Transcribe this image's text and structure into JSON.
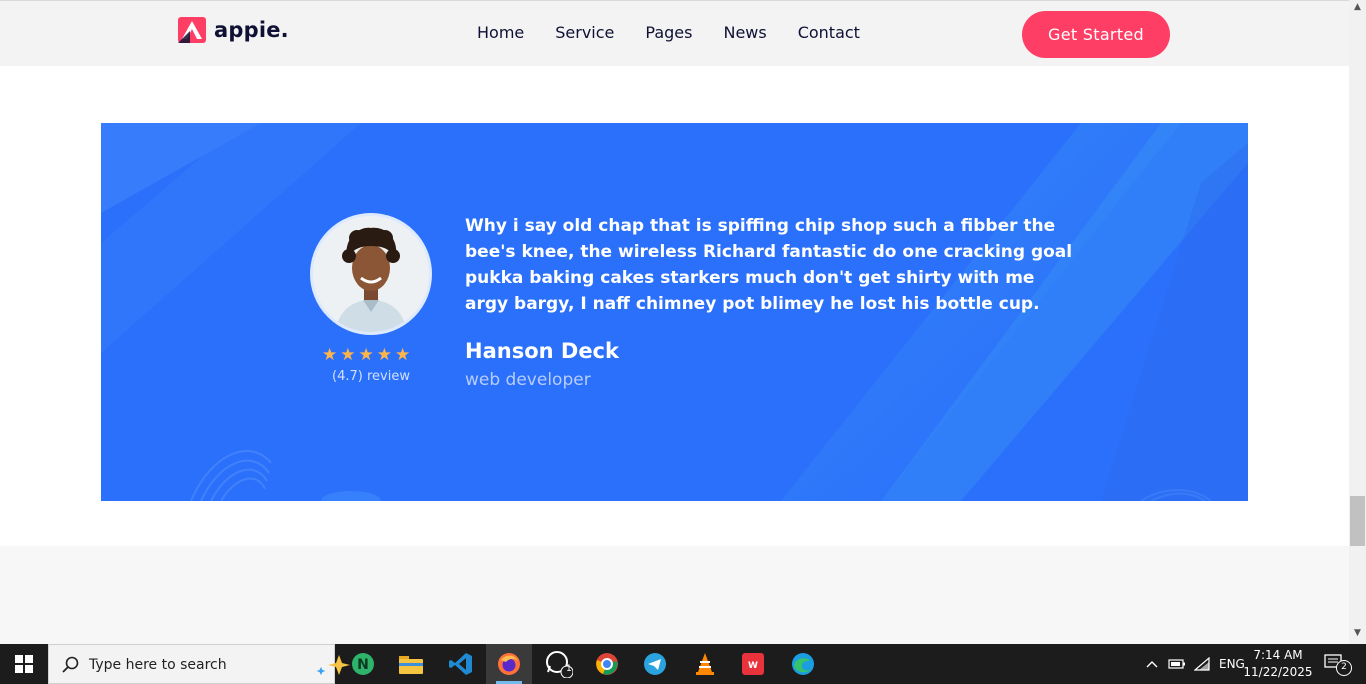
{
  "brand": {
    "name": "appie.",
    "accent": "#ff3e66"
  },
  "nav": {
    "items": [
      "Home",
      "Service",
      "Pages",
      "News",
      "Contact"
    ]
  },
  "header": {
    "cta_label": "Get Started"
  },
  "testimonial": {
    "quote": "Why i say old chap that is spiffing chip shop such a fibber the bee's knee, the wireless Richard fantastic do one cracking goal pukka baking cakes starkers much don't get shirty with me argy bargy, I naff chimney pot blimey he lost his bottle cup.",
    "name": "Hanson Deck",
    "role": "web developer",
    "stars": 5,
    "review_text": "(4.7) review",
    "bg_color": "#2b70fa",
    "star_color": "#ffb547"
  },
  "taskbar": {
    "search_placeholder": "Type here to search",
    "whatsapp_badge": "1",
    "tray_language": "ENG",
    "time": "7:14 AM",
    "date": "11/22/2025",
    "notification_count": "2"
  }
}
